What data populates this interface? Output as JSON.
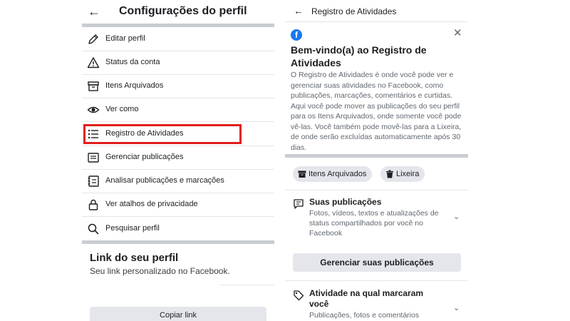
{
  "left_screen": {
    "title": "Configurações do perfil",
    "menu_items": [
      {
        "label": "Editar perfil",
        "icon": "pencil-icon"
      },
      {
        "label": "Status da conta",
        "icon": "warning-icon"
      },
      {
        "label": "Itens Arquivados",
        "icon": "archive-icon"
      },
      {
        "label": "Ver como",
        "icon": "eye-icon"
      },
      {
        "label": "Registro de Atividades",
        "icon": "list-icon",
        "highlighted": true
      },
      {
        "label": "Gerenciar publicações",
        "icon": "posts-icon"
      },
      {
        "label": "Analisar publicações e marcações",
        "icon": "review-icon"
      },
      {
        "label": "Ver atalhos de privacidade",
        "icon": "lock-icon"
      },
      {
        "label": "Pesquisar perfil",
        "icon": "search-icon"
      }
    ],
    "profile_link": {
      "title": "Link do seu perfil",
      "subtitle": "Seu link personalizado no Facebook.",
      "copy_button": "Copiar link"
    }
  },
  "right_screen": {
    "title": "Registro de Atividades",
    "welcome": {
      "title": "Bem-vindo(a) ao Registro de Atividades",
      "body": "O Registro de Atividades é onde você pode ver e gerenciar suas atividades no Facebook, como publicações, marcações, comentários e curtidas. Aqui você pode mover as publicações do seu perfil para os Itens Arquivados, onde somente você pode vê-las. Você também pode movê-las para a Lixeira, de onde serão excluídas automaticamente após 30 dias."
    },
    "chips": [
      {
        "label": "Itens Arquivados",
        "icon": "archive-icon"
      },
      {
        "label": "Lixeira",
        "icon": "trash-icon"
      }
    ],
    "sections": [
      {
        "title": "Suas publicações",
        "description": "Fotos, vídeos, textos e atualizações de status compartilhados por você no Facebook",
        "icon": "posts-bubble-icon",
        "button": "Gerenciar suas publicações"
      },
      {
        "title": "Atividade na qual marcaram você",
        "description": "Publicações, fotos e comentários",
        "icon": "tag-icon"
      }
    ]
  },
  "colors": {
    "highlight": "#e11d1d",
    "facebook_blue": "#1877f2",
    "separator": "#c9ccd1",
    "button_bg": "#e4e6eb"
  }
}
